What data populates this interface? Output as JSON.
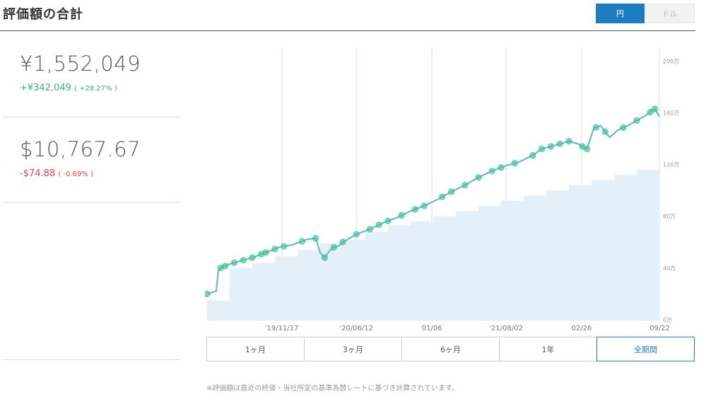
{
  "header": {
    "title": "評価額の合計",
    "currency_options": [
      "円",
      "ドル"
    ],
    "currency_selected": "円"
  },
  "summary": {
    "jpy": {
      "value": "¥1,552,049",
      "change": "+¥342,049",
      "change_pct": "( +28.27% )"
    },
    "usd": {
      "value": "$10,767.67",
      "change": "-$74.88",
      "change_pct": "( -0.69% )"
    }
  },
  "range_tabs": [
    "1ヶ月",
    "3ヶ月",
    "6ヶ月",
    "1年",
    "全期間"
  ],
  "range_selected": "全期間",
  "footnote": "※評価額は直近の終値・当社所定の基準為替レートに基づき計算されています。",
  "colors": {
    "accent": "#1d7dc2",
    "positive": "#3cb371",
    "negative": "#d14a4a",
    "line": "#6bb4e0",
    "area": "#e3f0f9",
    "marker": "#3cc48a"
  },
  "chart_data": {
    "type": "line",
    "y_unit": "万",
    "ylim": [
      0,
      210
    ],
    "y_ticks": [
      0,
      40,
      80,
      120,
      160,
      200
    ],
    "y_tick_labels": [
      "0万",
      "40万",
      "80万",
      "120万",
      "160万",
      "200万"
    ],
    "x_tick_labels": [
      "'19/11/17",
      "'20/06/12",
      "01/06",
      "'21/08/02",
      "02/26",
      "09/22"
    ],
    "x_tick_pos": [
      0.165,
      0.33,
      0.497,
      0.661,
      0.828,
      1.0
    ],
    "grid": "vertical",
    "series": [
      {
        "kind": "line",
        "x": [
          0,
          0.01,
          0.02,
          0.025,
          0.03,
          0.05,
          0.08,
          0.1,
          0.13,
          0.16,
          0.19,
          0.22,
          0.24,
          0.25,
          0.26,
          0.27,
          0.28,
          0.29,
          0.3,
          0.33,
          0.36,
          0.39,
          0.42,
          0.45,
          0.48,
          0.51,
          0.54,
          0.57,
          0.6,
          0.63,
          0.66,
          0.69,
          0.72,
          0.74,
          0.77,
          0.8,
          0.82,
          0.84,
          0.855,
          0.87,
          0.89,
          0.91,
          0.93,
          0.95,
          0.97,
          0.99,
          1.0
        ],
        "y": [
          20,
          21,
          22,
          38,
          40,
          43,
          46,
          48,
          52,
          56,
          58,
          62,
          63,
          52,
          48,
          53,
          56,
          57,
          60,
          66,
          70,
          75,
          79,
          84,
          88,
          93,
          99,
          104,
          110,
          115,
          119,
          122,
          127,
          132,
          135,
          138,
          136,
          132,
          148,
          150,
          141,
          147,
          150,
          154,
          158,
          163,
          157
        ]
      },
      {
        "kind": "area",
        "x": [
          0,
          0.05,
          0.1,
          0.15,
          0.2,
          0.25,
          0.3,
          0.35,
          0.4,
          0.45,
          0.5,
          0.55,
          0.6,
          0.65,
          0.7,
          0.75,
          0.8,
          0.85,
          0.9,
          0.95,
          1.0
        ],
        "y": [
          15,
          40,
          44,
          49,
          54,
          59,
          62,
          68,
          73,
          76,
          80,
          84,
          88,
          92,
          96,
          100,
          104,
          108,
          112,
          116,
          120
        ]
      }
    ],
    "markers_x": [
      0,
      0.03,
      0.04,
      0.06,
      0.08,
      0.1,
      0.12,
      0.13,
      0.15,
      0.17,
      0.21,
      0.24,
      0.26,
      0.28,
      0.3,
      0.33,
      0.36,
      0.38,
      0.4,
      0.43,
      0.46,
      0.48,
      0.52,
      0.54,
      0.57,
      0.6,
      0.63,
      0.65,
      0.68,
      0.72,
      0.74,
      0.76,
      0.78,
      0.8,
      0.83,
      0.84,
      0.86,
      0.88,
      0.92,
      0.95,
      0.98,
      0.99
    ]
  }
}
